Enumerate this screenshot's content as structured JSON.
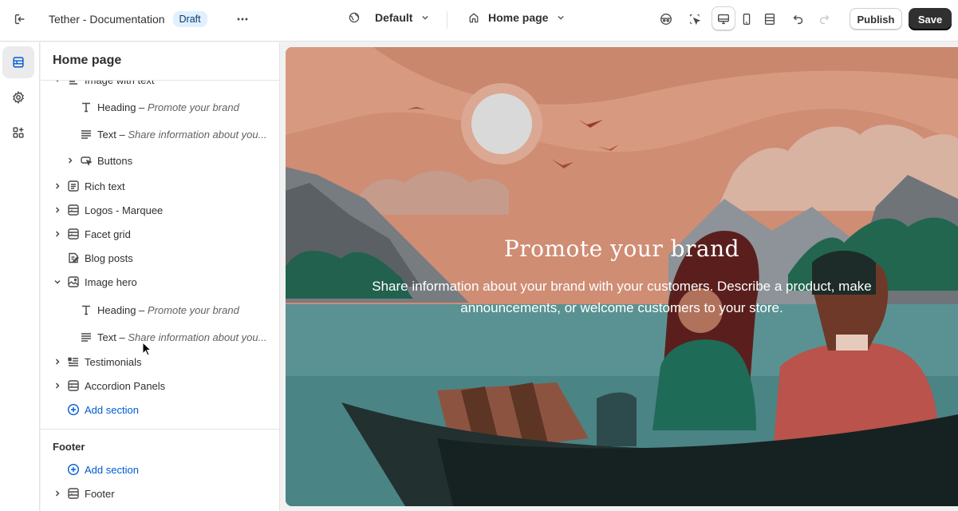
{
  "topbar": {
    "store_title": "Tether - Documentation",
    "status_badge": "Draft",
    "theme_dropdown": "Default",
    "page_dropdown": "Home page",
    "publish_label": "Publish",
    "save_label": "Save"
  },
  "rail": {
    "items": [
      {
        "icon": "sections-icon",
        "active": true
      },
      {
        "icon": "gear-icon",
        "active": false
      },
      {
        "icon": "apps-icon",
        "active": false
      }
    ]
  },
  "sidebar": {
    "title": "Home page",
    "tree": [
      {
        "label": "Image with text",
        "detail": "",
        "level": 0,
        "expanded": true,
        "icon": "image-text-icon",
        "partial": true
      },
      {
        "label": "Heading",
        "detail": "Promote your brand",
        "level": 1,
        "icon": "heading-icon"
      },
      {
        "label": "Text",
        "detail": "Share information about you...",
        "level": 1,
        "icon": "text-icon"
      },
      {
        "label": "Buttons",
        "detail": "",
        "level": 1,
        "expandable": true,
        "icon": "buttons-icon"
      },
      {
        "label": "Rich text",
        "detail": "",
        "level": 0,
        "expandable": true,
        "icon": "rich-text-icon"
      },
      {
        "label": "Logos - Marquee",
        "detail": "",
        "level": 0,
        "expandable": true,
        "icon": "section-icon"
      },
      {
        "label": "Facet grid",
        "detail": "",
        "level": 0,
        "expandable": true,
        "icon": "section-icon"
      },
      {
        "label": "Blog posts",
        "detail": "",
        "level": 0,
        "icon": "blog-icon"
      },
      {
        "label": "Image hero",
        "detail": "",
        "level": 0,
        "expanded": true,
        "icon": "image-icon"
      },
      {
        "label": "Heading",
        "detail": "Promote your brand",
        "level": 1,
        "icon": "heading-icon"
      },
      {
        "label": "Text",
        "detail": "Share information about you...",
        "level": 1,
        "icon": "text-icon"
      },
      {
        "label": "Testimonials",
        "detail": "",
        "level": 0,
        "expandable": true,
        "icon": "testimonials-icon"
      },
      {
        "label": "Accordion Panels",
        "detail": "",
        "level": 0,
        "expandable": true,
        "icon": "section-icon"
      }
    ],
    "add_section_label": "Add section",
    "footer_group_title": "Footer",
    "footer_add_section_label": "Add section",
    "footer_item_label": "Footer"
  },
  "preview": {
    "hero_heading": "Promote your brand",
    "hero_text": "Share information about your brand with your customers. Describe a product, make announcements, or welcome customers to your store."
  }
}
